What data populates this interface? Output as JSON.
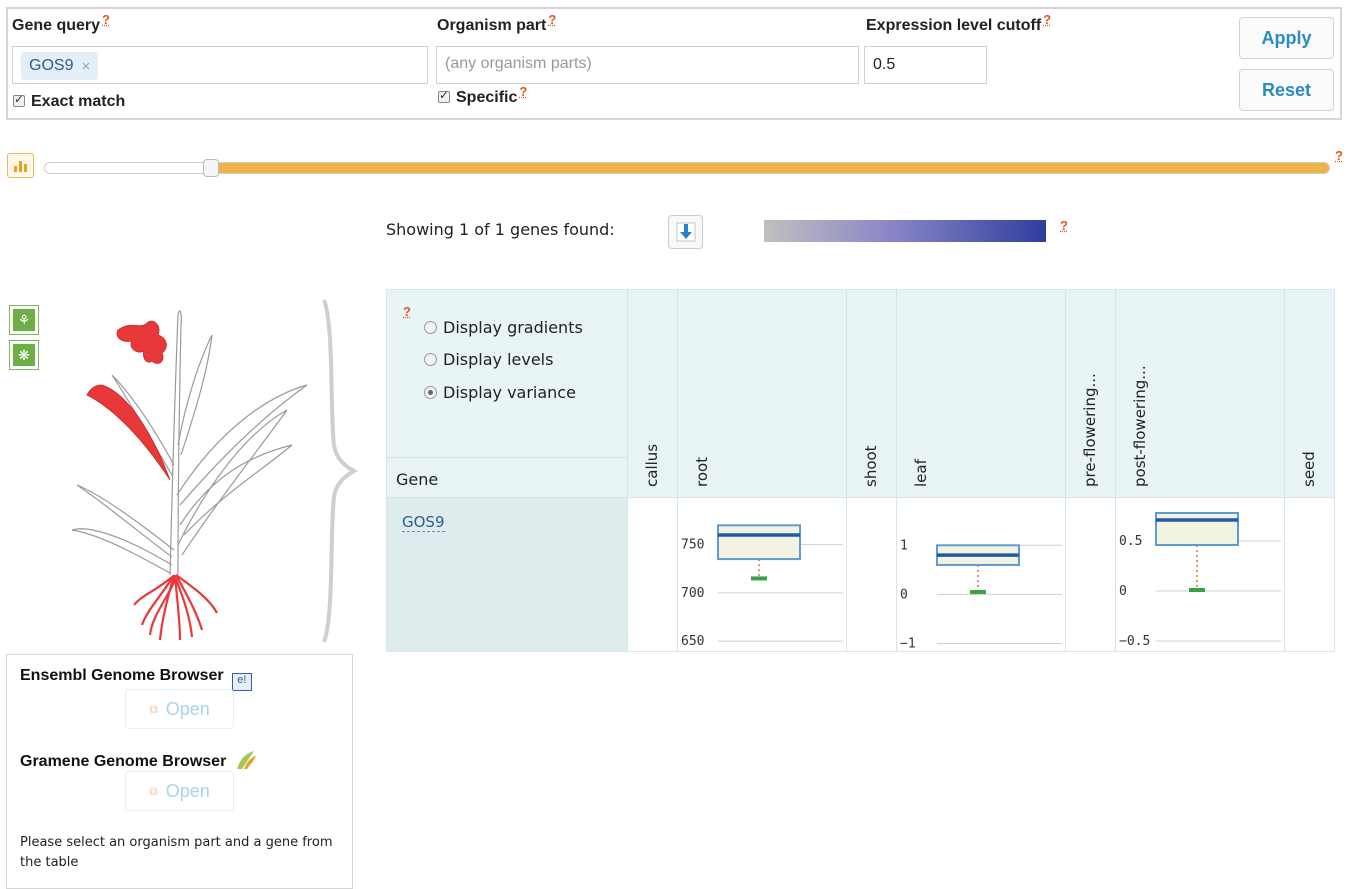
{
  "query": {
    "gene_label": "Gene query",
    "gene_tag": "GOS9",
    "exact_match_label": "Exact match",
    "organism_label": "Organism part",
    "organism_placeholder": "(any organism parts)",
    "specific_label": "Specific",
    "cutoff_label": "Expression level cutoff",
    "cutoff_value": "0.5",
    "help": "?",
    "apply_label": "Apply",
    "reset_label": "Reset"
  },
  "slider": {
    "value_fraction": 0.13
  },
  "results": {
    "showing_text": "Showing 1 of 1 genes found:"
  },
  "heatmap": {
    "display_options": [
      {
        "label": "Display gradients",
        "selected": false
      },
      {
        "label": "Display levels",
        "selected": false
      },
      {
        "label": "Display variance",
        "selected": true
      }
    ],
    "gene_header": "Gene",
    "gene_name": "GOS9",
    "columns": [
      "callus",
      "root",
      "shoot",
      "leaf",
      "pre-flowering...",
      "post-flowering...",
      "seed"
    ],
    "boxplots": {
      "root": {
        "ticks": [
          "750",
          "700",
          "650"
        ],
        "tick_values": [
          750,
          700,
          650
        ],
        "ylim": [
          645,
          790
        ],
        "q1": 735,
        "median": 760,
        "q3": 770,
        "whisker_min": 715,
        "whisker_max": 770
      },
      "leaf": {
        "ticks": [
          "1",
          "0",
          "−1"
        ],
        "tick_values": [
          1,
          0,
          -1
        ],
        "ylim": [
          -1.05,
          1.8
        ],
        "q1": 0.6,
        "median": 0.8,
        "q3": 1.0,
        "whisker_min": 0.05,
        "whisker_max": 1.0
      },
      "post_flowering": {
        "ticks": [
          "0.5",
          "0",
          "−0.5"
        ],
        "tick_values": [
          0.5,
          0,
          -0.5
        ],
        "ylim": [
          -0.55,
          0.85
        ],
        "q1": 0.46,
        "median": 0.71,
        "q3": 0.78,
        "whisker_min": 0.01,
        "whisker_max": 0.78
      }
    },
    "colors": {
      "box_border": "#5d9ad6",
      "box_fill": "#f3f3e1",
      "median": "#1f5aa8",
      "whisker": "#e26a4f",
      "min_marker": "#3aa047",
      "gridline": "#cfcfcf"
    }
  },
  "browsers": {
    "ensembl_title": "Ensembl Genome Browser",
    "gramene_title": "Gramene Genome Browser",
    "open_label": "Open",
    "hint": "Please select an organism part and a gene from the table"
  },
  "icons": {
    "help": "help-icon",
    "slider": "bar-chart-icon",
    "download": "download-icon",
    "anatomy_plant": "plant-icon",
    "anatomy_flower": "flower-icon",
    "ensembl": "ensembl-logo-icon",
    "gramene": "gramene-logo-icon",
    "open": "external-link-icon"
  },
  "colors": {
    "accent": "#2a8cc4",
    "slider_fill": "#f0b34a",
    "highlight": "#e8393a",
    "help": "#e8541e"
  }
}
